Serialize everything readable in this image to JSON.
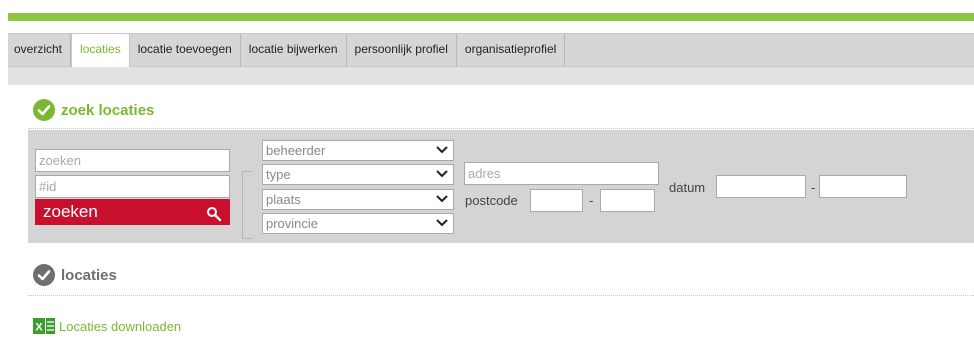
{
  "tabs": [
    {
      "label": "overzicht",
      "active": false
    },
    {
      "label": "locaties",
      "active": true
    },
    {
      "label": "locatie toevoegen",
      "active": false
    },
    {
      "label": "locatie bijwerken",
      "active": false
    },
    {
      "label": "persoonlijk profiel",
      "active": false
    },
    {
      "label": "organisatieprofiel",
      "active": false
    }
  ],
  "search_section": {
    "title": "zoek locaties",
    "search_placeholder": "zoeken",
    "id_placeholder": "#id",
    "search_button": "zoeken",
    "beheerder": "beheerder",
    "type": "type",
    "plaats": "plaats",
    "provincie": "provincie",
    "adres_placeholder": "adres",
    "postcode_label": "postcode",
    "postcode_sep": "-",
    "datum_label": "datum",
    "datum_sep": "-"
  },
  "results_section": {
    "title": "locaties",
    "download_link": "Locaties downloaden"
  },
  "colors": {
    "accent_green": "#7cb82f",
    "top_strip": "#8dc63f",
    "button_red": "#c8102e",
    "panel_grey": "#d4d4d4"
  },
  "icons": {
    "check": "check-circle-icon",
    "magnifier": "search-icon",
    "dropdown": "chevron-down-icon",
    "excel": "excel-icon"
  }
}
